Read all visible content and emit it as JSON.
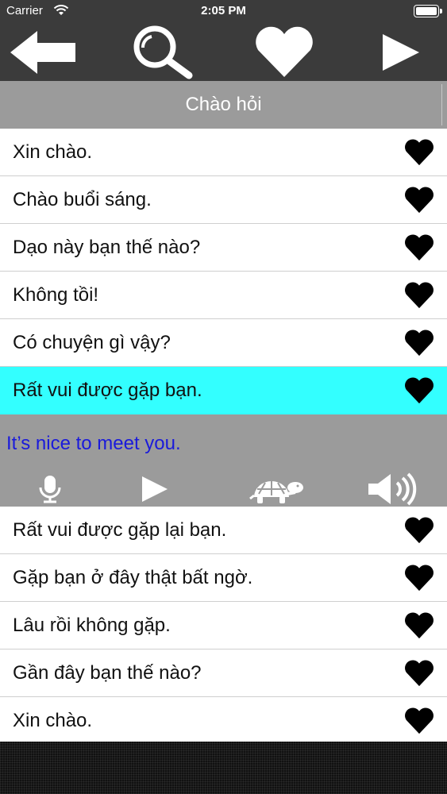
{
  "status_bar": {
    "carrier": "Carrier",
    "time": "2:05 PM"
  },
  "toolbar": {
    "back_icon": "back-arrow-icon",
    "search_icon": "magnifier-icon",
    "favorites_icon": "heart-icon",
    "play_icon": "play-icon"
  },
  "section": {
    "title": "Chào hỏi"
  },
  "phrases": [
    {
      "text": "Xin chào."
    },
    {
      "text": "Chào buổi sáng."
    },
    {
      "text": "Dạo này bạn thế nào?"
    },
    {
      "text": "Không tồi!"
    },
    {
      "text": "Có chuyện gì vậy?"
    },
    {
      "text": "Rất vui được gặp bạn.",
      "selected": true
    },
    {
      "text": "Rất vui được gặp lại bạn."
    },
    {
      "text": "Gặp bạn ở đây thật bất ngờ."
    },
    {
      "text": "Lâu rồi không gặp."
    },
    {
      "text": "Gần đây bạn thế nào?"
    },
    {
      "text": "Xin chào."
    }
  ],
  "detail": {
    "translation": "It’s nice to meet you.",
    "controls": [
      "microphone-icon",
      "play-icon",
      "turtle-slow-icon",
      "speaker-icon"
    ]
  },
  "colors": {
    "toolbar_bg": "#3b3b3b",
    "header_bg": "#9b9b9b",
    "selected_row": "#33ffff",
    "translation_text": "#1a1adb"
  }
}
